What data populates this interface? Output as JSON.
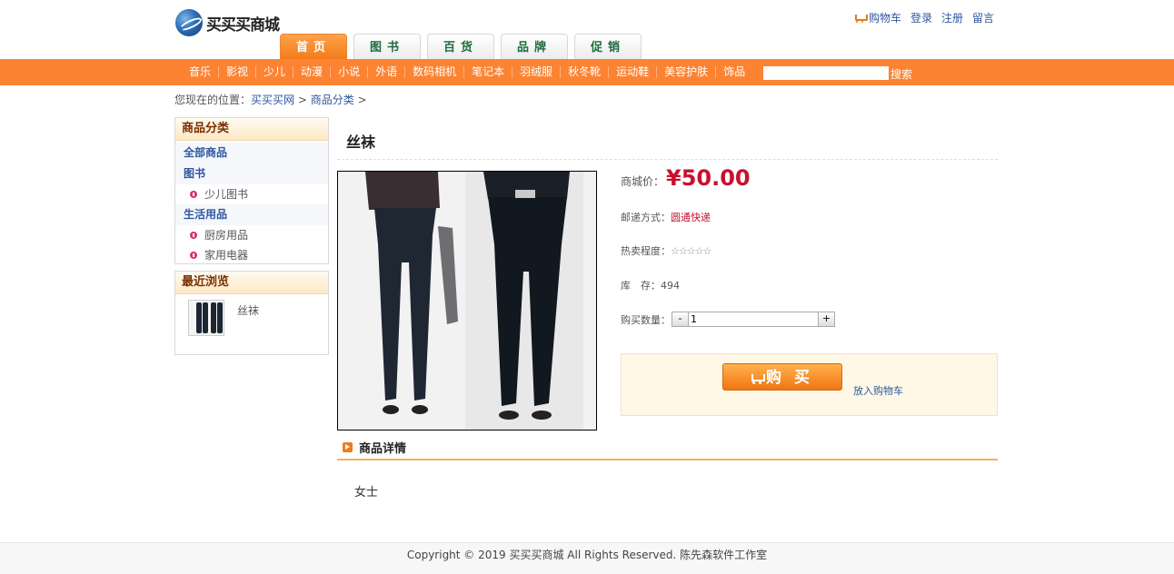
{
  "site": {
    "logo_text": "买买买商城"
  },
  "top_links": {
    "cart": "购物车",
    "login": "登录",
    "register": "注册",
    "message": "留言"
  },
  "tabs": [
    {
      "label": "首页",
      "active": true
    },
    {
      "label": "图书",
      "active": false
    },
    {
      "label": "百货",
      "active": false
    },
    {
      "label": "品牌",
      "active": false
    },
    {
      "label": "促销",
      "active": false
    }
  ],
  "categories": [
    "音乐",
    "影视",
    "少儿",
    "动漫",
    "小说",
    "外语",
    "数码相机",
    "笔记本",
    "羽绒服",
    "秋冬靴",
    "运动鞋",
    "美容护肤",
    "饰品"
  ],
  "search": {
    "value": "",
    "button": "搜索"
  },
  "breadcrumb": {
    "prefix": "您现在的位置：",
    "home": "买买买网",
    "sep1": ">",
    "category": "商品分类",
    "sep2": ">"
  },
  "sidebar": {
    "category_title": "商品分类",
    "all_label": "全部商品",
    "groups": [
      {
        "label": "图书",
        "items": [
          "少儿图书"
        ]
      },
      {
        "label": "生活用品",
        "items": [
          "厨房用品",
          "家用电器"
        ]
      }
    ],
    "recent_title": "最近浏览",
    "recent_items": [
      "丝袜"
    ]
  },
  "product": {
    "name": "丝袜",
    "price_label": "商城价：",
    "price": "¥50.00",
    "shipping_label": "邮递方式：",
    "shipping": "圆通快递",
    "hot_label": "热卖程度：",
    "hot_stars": "☆☆☆☆☆",
    "stock_label": "库　存：",
    "stock": "494",
    "qty_label": "购买数量：",
    "qty": "1",
    "minus": "-",
    "plus": "+",
    "buy_label": "购买",
    "add_cart": "放入购物车"
  },
  "details": {
    "title": "商品详情",
    "text": "女士"
  },
  "footer": {
    "text": "Copyright © 2019 买买买商城 All Rights Reserved. 陈先森软件工作室"
  },
  "colors": {
    "accent": "#fc8332",
    "price": "#c8102e",
    "link": "#2d57a0"
  },
  "icons": [
    "globe-logo-icon",
    "cart-icon",
    "bullet-icon",
    "arrow-icon"
  ]
}
